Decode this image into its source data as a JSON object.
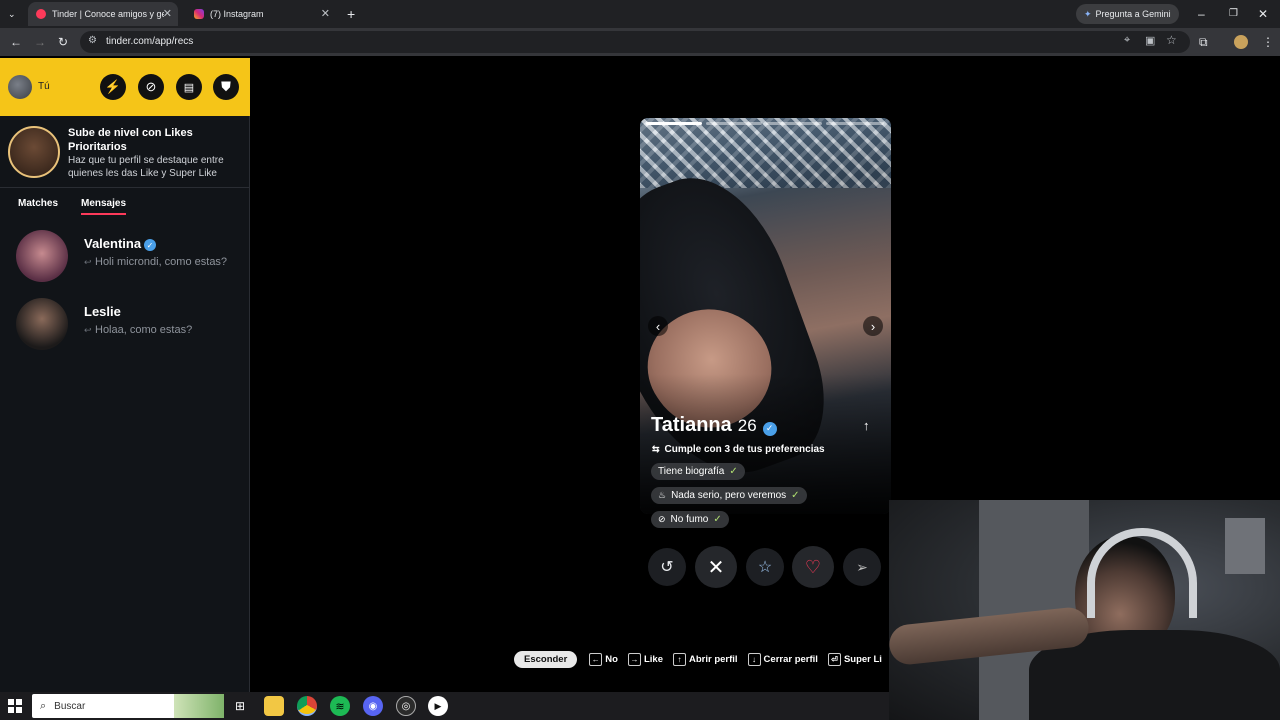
{
  "browser": {
    "tabs": [
      {
        "title": "Tinder | Conoce amigos y gente",
        "active": true
      },
      {
        "title": "(7) Instagram",
        "active": false
      }
    ],
    "url": "tinder.com/app/recs",
    "gemini_label": "Pregunta a Gemini"
  },
  "sidebar": {
    "user_label": "Tú",
    "promo": {
      "title": "Sube de nivel con Likes Prioritarios",
      "subtitle": "Haz que tu perfil se destaque entre quienes les das Like y Super Like"
    },
    "tabs": [
      {
        "label": "Matches",
        "active": false
      },
      {
        "label": "Mensajes",
        "active": true
      }
    ],
    "matches": [
      {
        "name": "Valentina",
        "verified": true,
        "message": "Holi microndi, como estas?"
      },
      {
        "name": "Leslie",
        "verified": false,
        "message": "Holaa, como estas?"
      }
    ]
  },
  "profile": {
    "name": "Tatianna",
    "age": "26",
    "verified": true,
    "preferences": "Cumple con 3 de tus preferencias",
    "tags": [
      {
        "label": "Tiene biografía"
      },
      {
        "label": "Nada serio, pero veremos"
      },
      {
        "label": "No fumo"
      }
    ],
    "photo_count": 4,
    "current_photo": 1
  },
  "shortcuts": {
    "hide": "Esconder",
    "items": [
      {
        "key": "←",
        "label": "No"
      },
      {
        "key": "→",
        "label": "Like"
      },
      {
        "key": "↑",
        "label": "Abrir perfil"
      },
      {
        "key": "↓",
        "label": "Cerrar perfil"
      },
      {
        "key": "⏎",
        "label": "Super Li"
      }
    ]
  },
  "taskbar": {
    "search_placeholder": "Buscar"
  },
  "colors": {
    "brand_yellow": "#f5c518",
    "like_red": "#fd3a5a",
    "verified_blue": "#4a9fe8"
  }
}
